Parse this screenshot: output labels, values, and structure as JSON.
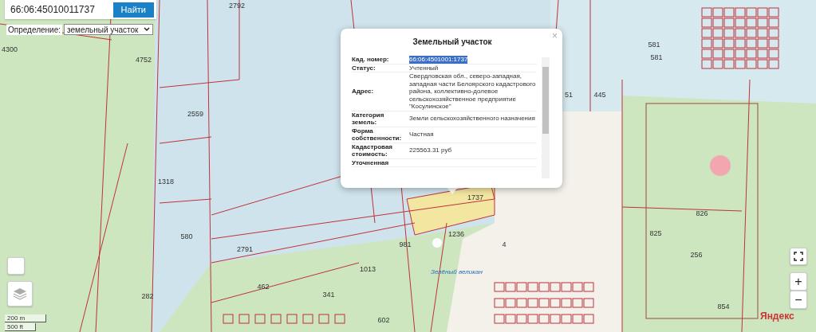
{
  "search": {
    "value": "66:06:45010011737",
    "button": "Найти"
  },
  "definition": {
    "label": "Определение:",
    "value": "земельный участок"
  },
  "popup": {
    "title": "Земельный участок",
    "close": "×",
    "rows": [
      {
        "label": "Кад. номер:",
        "value": "66:06:4501001:1737",
        "highlighted": true
      },
      {
        "label": "Статус:",
        "value": "Учтенный"
      },
      {
        "label": "Адрес:",
        "value": "Свердловская обл., северо-западная, западная части Белоярского кадастрового района, коллективно-долевое сельскохозяйственное предприятие \"Косулинское\""
      },
      {
        "label": "Категория земель:",
        "value": "Земли сельскохозяйственного назначения"
      },
      {
        "label": "Форма собственности:",
        "value": "Частная"
      },
      {
        "label": "Кадастровая стоимость:",
        "value": "225563.31 руб"
      },
      {
        "label": "Уточненная"
      }
    ]
  },
  "map_labels": [
    "2792",
    "4300",
    "4752",
    "2559",
    "1318",
    "580",
    "2791",
    "462",
    "1013",
    "981",
    "1236",
    "4",
    "1737",
    "341",
    "602",
    "581",
    "581",
    "445",
    "51",
    "826",
    "825",
    "256",
    "854",
    "282"
  ],
  "poi": {
    "name": "Зелёный великан"
  },
  "controls": {
    "zoom_in": "+",
    "zoom_out": "−"
  },
  "scale": [
    "200 m",
    "500 ft"
  ],
  "logo": "Яндекс"
}
